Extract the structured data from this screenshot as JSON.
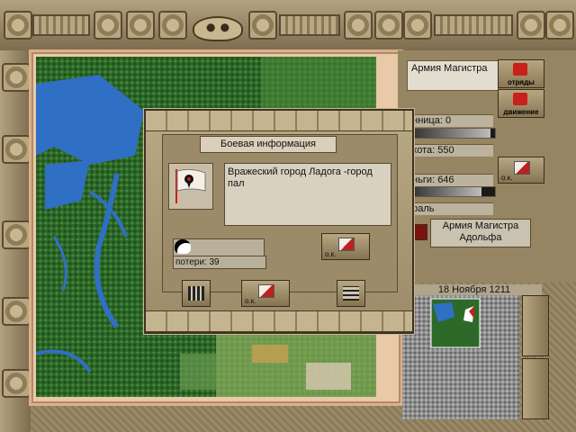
{
  "army": {
    "name": "Армия Магистра",
    "btn_units": "отряды",
    "btn_move": "движение",
    "stat_cavalry": "онница: 0",
    "stat_infantry": "ехота: 550",
    "stat_money": "еньги: 646",
    "stat_morale": "ораль",
    "bar_cavalry": 0.05,
    "bar_money": 0.85,
    "ok_label": "о.к.",
    "army_box": "Армия Магистра Адольфа"
  },
  "date": "18 Ноября 1211",
  "dialog": {
    "title": "Боевая информация",
    "message": "Вражеский город Ладога -город пал",
    "losses": "потери: 39",
    "ok_label_right": "о.к.",
    "ok_label_bottom": "о.к."
  },
  "icons": [
    "skull-icon",
    "flag-icon",
    "ok-icon",
    "army-icon",
    "list-icon"
  ],
  "colors": {
    "water": "#2f6fc4",
    "forest": "#2d6a2a",
    "parchment": "#e8c9a8",
    "red": "#c8201a"
  }
}
